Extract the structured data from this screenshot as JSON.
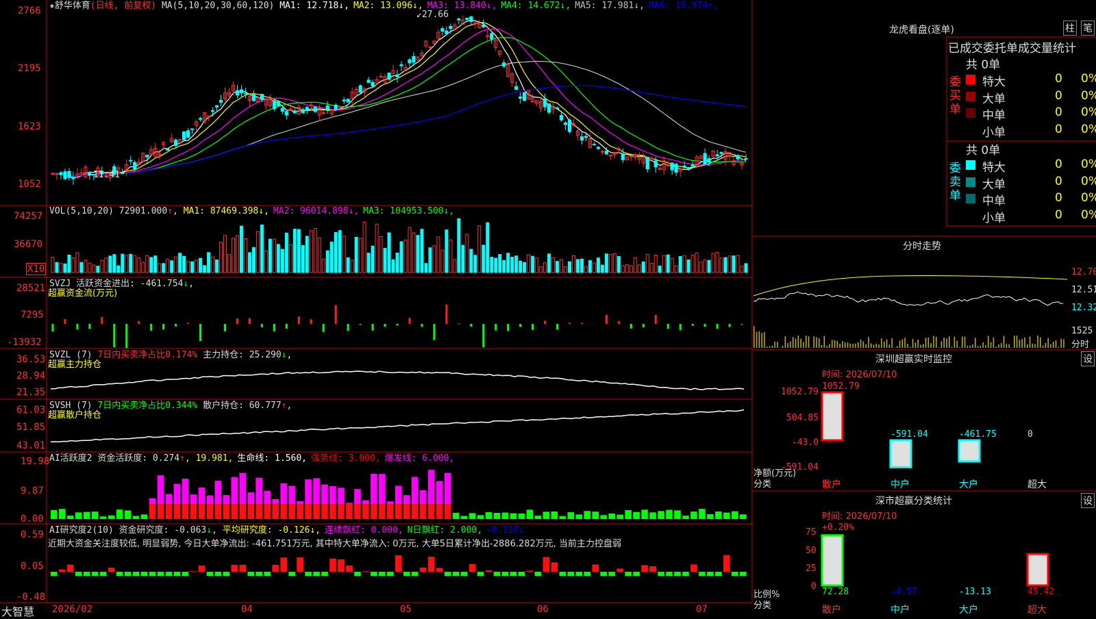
{
  "stock": {
    "name": "舒华体育",
    "mode": "(日线, 前复权)",
    "ma_spec": "MA(5,10,20,30,60,120)",
    "ma": [
      {
        "label": "MA1:",
        "value": "12.718",
        "arrow": "↓",
        "color": "#ffffff"
      },
      {
        "label": "MA2:",
        "value": "13.096",
        "arrow": "↓",
        "color": "#ffff00"
      },
      {
        "label": "MA3:",
        "value": "13.840",
        "arrow": "↓",
        "color": "#ff00ff"
      },
      {
        "label": "MA4:",
        "value": "14.672",
        "arrow": "↓",
        "color": "#00ff00"
      },
      {
        "label": "MA5:",
        "value": "17.981",
        "arrow": "↓",
        "color": "#c0c0c0"
      },
      {
        "label": "MA6:",
        "value": "15.974",
        "arrow": "↑",
        "color": "#0000ff"
      }
    ],
    "high_marker": "27.66",
    "low_marker": "11.41"
  },
  "axes": {
    "price": [
      "2766",
      "2195",
      "1623",
      "1052"
    ],
    "vol": [
      "74257",
      "36670",
      "X10"
    ],
    "svzj": [
      "28521",
      "7295",
      "-13932"
    ],
    "svzl": [
      "36.53",
      "28.94",
      "21.35"
    ],
    "svsh": [
      "61.03",
      "51.85",
      "43.01"
    ],
    "ai_active": [
      "19.98",
      "9.87",
      "0.00"
    ],
    "ai_research": [
      "0.59",
      "0.05",
      "-0.48"
    ]
  },
  "panels": {
    "vol": {
      "spec": "VOL(5,10,20)",
      "value": "72901.000",
      "arrow": "↑",
      "mas": [
        {
          "label": "MA1:",
          "value": "87469.398",
          "arrow": "↓",
          "color": "#ffff00"
        },
        {
          "label": "MA2:",
          "value": "96014.898",
          "arrow": "↓",
          "color": "#ff00ff"
        },
        {
          "label": "MA3:",
          "value": "104953.500",
          "arrow": "↓",
          "color": "#00ff00"
        }
      ]
    },
    "svzj": {
      "name": "SVZJ",
      "label": "活跃资金进出:",
      "value": "-461.754",
      "arrow": "↓",
      "subtitle": "超赢资金流(万元)"
    },
    "svzl": {
      "name": "SVZL (7)",
      "label": "7日内买卖净占比0.174%",
      "label2": "主力持仓:",
      "value": "25.290",
      "arrow": "↓",
      "subtitle": "超赢主力持仓"
    },
    "svsh": {
      "name": "SVSH (7)",
      "label": "7日内买卖净占比0.344%",
      "label2": "散户持仓:",
      "value": "60.777",
      "arrow": "↑",
      "subtitle": "超赢散户持仓"
    },
    "ai_active": {
      "name": "AI活跃度2",
      "label": "资金活跃度:",
      "value": "0.274",
      "arrow": "↑",
      "extra": [
        {
          "text": "19.981,",
          "color": "#ffff00"
        },
        {
          "text": "生命线: 1.560,",
          "color": "#ffffff"
        },
        {
          "text": "强势线: 3.000,",
          "color": "#ff0000"
        },
        {
          "text": "爆发线: 6.000,",
          "color": "#ff00ff"
        }
      ]
    },
    "ai_research": {
      "name": "AI研究度2(10)",
      "label": "资金研究度:",
      "value": "-0.063",
      "arrow": "↓",
      "extra": [
        {
          "text": "平均研究度: -0.126↓,",
          "color": "#ffff00"
        },
        {
          "text": "连续飘红: 0.000,",
          "color": "#ff00ff"
        },
        {
          "text": "N日飘红: 2.000,",
          "color": "#00ff00"
        },
        {
          "text": "-0.126↓",
          "color": "#0000ff"
        }
      ],
      "comment": "近期大资金关注度较低, 明显弱势, 今日大单净流出: -461.751万元, 其中特大单净流入: 0万元, 大单5日累计净出-2886.282万元, 当前主力控盘弱"
    }
  },
  "x_axis": {
    "brand": "大智慧",
    "labels": [
      "2026/02",
      "04",
      "05",
      "06",
      "07"
    ]
  },
  "right": {
    "longhu": {
      "title": "龙虎看盘(逐单)",
      "btn1": "柱",
      "btn2": "笔",
      "tabs": "已成交委托单成交量统计",
      "buy": {
        "side": "委买单",
        "total": "共 0单",
        "rows": [
          {
            "label": "特大",
            "count": "0",
            "pct": "0%",
            "color": "#ff0000"
          },
          {
            "label": "大单",
            "count": "0",
            "pct": "0%",
            "color": "#990000"
          },
          {
            "label": "中单",
            "count": "0",
            "pct": "0%",
            "color": "#660000"
          },
          {
            "label": "小单",
            "count": "0",
            "pct": "0%",
            "color": ""
          }
        ]
      },
      "sell": {
        "side": "委卖单",
        "total": "共 0单",
        "rows": [
          {
            "label": "特大",
            "count": "0",
            "pct": "0%",
            "color": "#00ffff"
          },
          {
            "label": "大单",
            "count": "0",
            "pct": "0%",
            "color": "#008b8b"
          },
          {
            "label": "中单",
            "count": "0",
            "pct": "0%",
            "color": "#006b6b"
          },
          {
            "label": "小单",
            "count": "0",
            "pct": "0%",
            "color": ""
          }
        ]
      }
    },
    "fenshi": {
      "title": "分时走势",
      "p1": "12.70",
      "p2": "12.51",
      "p3": "12.32",
      "vol": "1525",
      "unit": "分时"
    },
    "monitor": {
      "title": "深圳超赢实时监控",
      "btn": "设",
      "time": "时间: 2026/07/10",
      "axis": [
        "1052.79",
        "504.85",
        "-43.0",
        "-591.04"
      ],
      "ylabel": "净额(万元)",
      "xlabel": "分类",
      "bars": [
        {
          "cat": "散户",
          "value": 1052.79,
          "label": "1052.79",
          "color": "#ff0000"
        },
        {
          "cat": "中户",
          "value": -591.04,
          "label": "-591.04",
          "color": "#00ffff"
        },
        {
          "cat": "大户",
          "value": -461.75,
          "label": "-461.75",
          "color": "#00ffff"
        },
        {
          "cat": "超大",
          "value": 0,
          "label": "0",
          "color": "#ffffff"
        }
      ]
    },
    "stats": {
      "title": "深市超赢分类统计",
      "btn": "设",
      "time": "时间: 2026/07/10",
      "top": "+0.20%",
      "axis": [
        "75",
        "50",
        "25",
        "0"
      ],
      "ylabel": "比例%",
      "xlabel": "分类",
      "bars": [
        {
          "cat": "散户",
          "value": 72.28,
          "label": "72.28",
          "color": "#00ff00"
        },
        {
          "cat": "中户",
          "value": 4.57,
          "label": "-4.57",
          "color": "#0000ff"
        },
        {
          "cat": "大户",
          "value": 13.13,
          "label": "-13.13",
          "color": "#00ffff"
        },
        {
          "cat": "超大",
          "value": 45.42,
          "label": "45.42",
          "color": "#ff0000"
        }
      ]
    }
  }
}
